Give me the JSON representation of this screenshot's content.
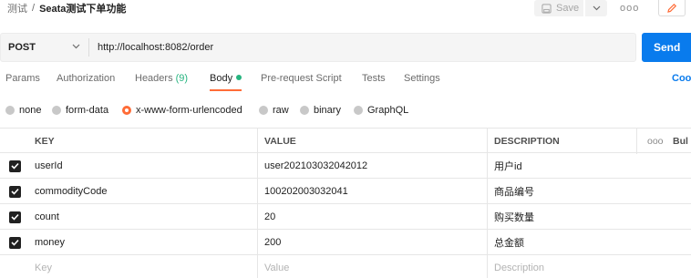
{
  "header": {
    "breadcrumb_parent": "测试",
    "breadcrumb_sep": "/",
    "title": "Seata测试下单功能",
    "save_label": "Save",
    "more_label": "ooo"
  },
  "request": {
    "method": "POST",
    "url": "http://localhost:8082/order",
    "send_label": "Send"
  },
  "tabs": [
    {
      "label": "Params"
    },
    {
      "label": "Authorization"
    },
    {
      "label": "Headers",
      "count": "(9)"
    },
    {
      "label": "Body",
      "active": true
    },
    {
      "label": "Pre-request Script"
    },
    {
      "label": "Tests"
    },
    {
      "label": "Settings"
    }
  ],
  "cookies_label": "Coo",
  "body_types": [
    {
      "label": "none"
    },
    {
      "label": "form-data"
    },
    {
      "label": "x-www-form-urlencoded",
      "selected": true
    },
    {
      "label": "raw"
    },
    {
      "label": "binary"
    },
    {
      "label": "GraphQL"
    }
  ],
  "table": {
    "headers": {
      "key": "KEY",
      "value": "VALUE",
      "description": "DESCRIPTION",
      "more": "ooo",
      "bulk": "Bul"
    },
    "rows": [
      {
        "key": "userId",
        "value": "user202103032042012",
        "description": "用户id"
      },
      {
        "key": "commodityCode",
        "value": "100202003032041",
        "description": "商品编号"
      },
      {
        "key": "count",
        "value": "20",
        "description": "购买数量"
      },
      {
        "key": "money",
        "value": "200",
        "description": "总金额"
      }
    ],
    "placeholders": {
      "key": "Key",
      "value": "Value",
      "description": "Description"
    }
  },
  "colors": {
    "accent": "#ff6c37",
    "send": "#097bed",
    "status_green": "#26b47f"
  }
}
